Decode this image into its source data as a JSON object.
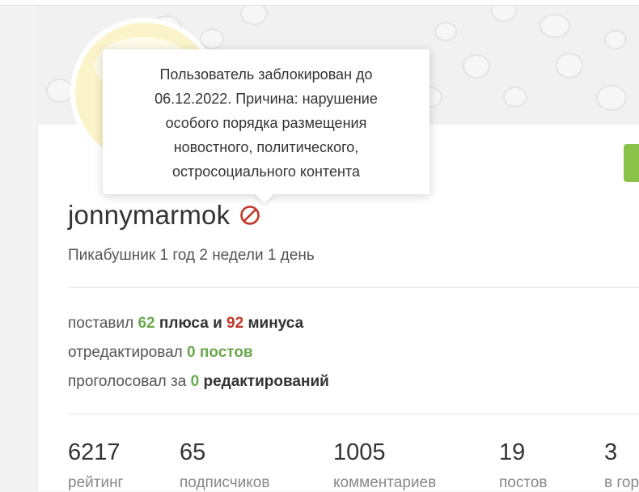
{
  "tooltip": {
    "lines": [
      "Пользователь заблокирован до",
      "06.12.2022. Причина: нарушение",
      "особого порядка размещения",
      "новостного, политического,",
      "остросоциального контента"
    ]
  },
  "profile": {
    "username": "jonnymarmok",
    "member_since": "Пикабушник 1 год 2 недели 1 день",
    "ban_icon": "ban-icon"
  },
  "activity": {
    "line1": {
      "prefix": "поставил ",
      "plus_count": "62",
      "plus_label": " плюса",
      "and": " и ",
      "minus_count": "92",
      "minus_label": " минуса"
    },
    "line2": {
      "prefix": "отредактировал ",
      "count": "0",
      "label": " постов"
    },
    "line3": {
      "prefix": "проголосовал за ",
      "count": "0",
      "label": " редактирований"
    }
  },
  "counters": [
    {
      "value": "6217",
      "label": "рейтинг"
    },
    {
      "value": "65",
      "label": "подписчиков"
    },
    {
      "value": "1005",
      "label": "комментариев"
    },
    {
      "value": "19",
      "label": "постов"
    },
    {
      "value": "3",
      "label": "в гор"
    }
  ],
  "colors": {
    "plus": "#6aa84f",
    "minus": "#c0392b",
    "accent_green": "#8bc34a"
  }
}
